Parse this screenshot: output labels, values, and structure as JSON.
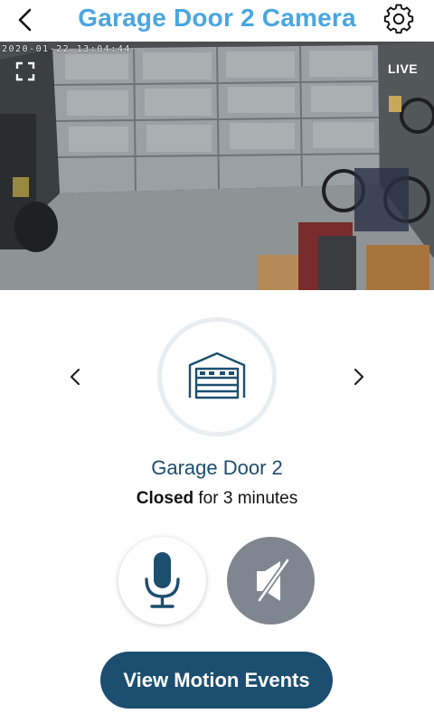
{
  "header": {
    "title": "Garage Door 2 Camera",
    "back_icon": "chevron-left-icon",
    "settings_icon": "gear-icon"
  },
  "video": {
    "timestamp": "2020-01-22 13:04:44",
    "live_label": "LIVE",
    "fullscreen_icon": "fullscreen-icon"
  },
  "device": {
    "name": "Garage Door 2",
    "state": "Closed",
    "duration": " for 3 minutes",
    "icon": "garage-door-icon",
    "prev_icon": "chevron-left-icon",
    "next_icon": "chevron-right-icon"
  },
  "controls": {
    "mic_icon": "microphone-icon",
    "speaker_icon": "speaker-muted-icon"
  },
  "actions": {
    "motion_events_label": "View Motion Events"
  },
  "colors": {
    "title": "#4aa6e0",
    "primary_dark": "#1c4f6f",
    "muted_button": "#7f8690"
  }
}
